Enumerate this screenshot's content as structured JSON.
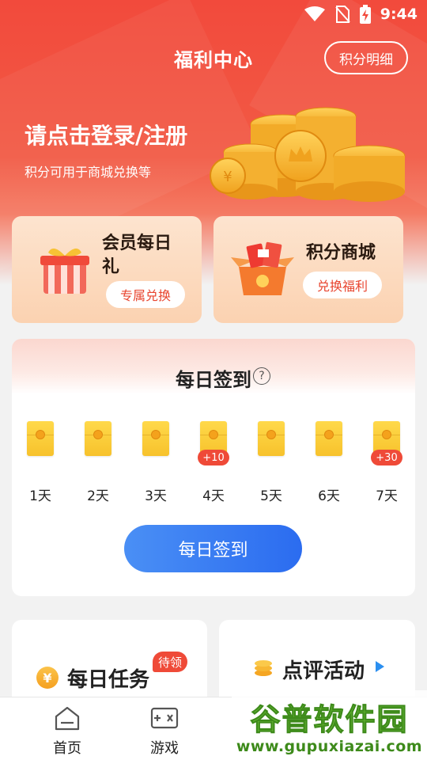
{
  "status_bar": {
    "time": "9:44",
    "icons": [
      "wifi-icon",
      "no-sim-icon",
      "battery-charging-icon"
    ]
  },
  "header": {
    "title": "福利中心",
    "points_detail_button": "积分明细"
  },
  "banner": {
    "login_title": "请点击登录/注册",
    "login_subtitle": "积分可用于商城兑换等"
  },
  "promos": [
    {
      "title": "会员每日礼",
      "title_line1": "会员每日",
      "title_line2": "礼",
      "button": "专属兑换",
      "icon": "gift-box-icon"
    },
    {
      "title": "积分商城",
      "button": "兑换福利",
      "icon": "red-envelope-box-icon"
    }
  ],
  "checkin": {
    "title": "每日签到",
    "help_icon": "?",
    "days": [
      {
        "label": "1天",
        "bonus": ""
      },
      {
        "label": "2天",
        "bonus": ""
      },
      {
        "label": "3天",
        "bonus": ""
      },
      {
        "label": "4天",
        "bonus": "+10"
      },
      {
        "label": "5天",
        "bonus": ""
      },
      {
        "label": "6天",
        "bonus": ""
      },
      {
        "label": "7天",
        "bonus": "+30"
      }
    ],
    "button": "每日签到"
  },
  "tasks": {
    "title": "每日任务",
    "badge": "待领",
    "icon_glyph": "¥"
  },
  "review": {
    "title": "点评活动",
    "subtitle": "..."
  },
  "bottom_nav": {
    "items": [
      {
        "label": "首页",
        "icon": "home-icon"
      },
      {
        "label": "游戏",
        "icon": "gamepad-icon"
      }
    ]
  },
  "watermark": {
    "name": "谷普软件园",
    "url": "www.gupuxiazai.com"
  },
  "colors": {
    "brand_red": "#f24a3c",
    "button_blue": "#2b6cf0",
    "envelope_gold": "#f7c22c"
  }
}
